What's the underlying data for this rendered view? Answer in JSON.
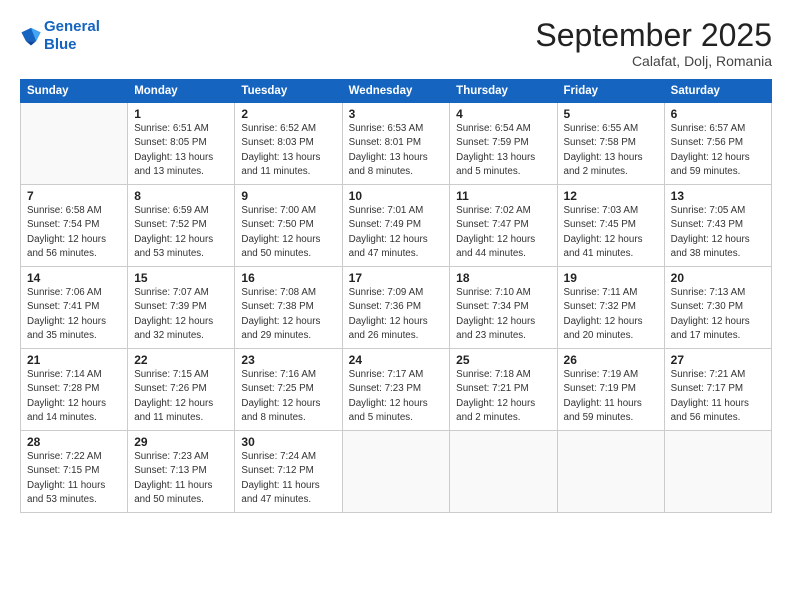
{
  "logo": {
    "line1": "General",
    "line2": "Blue"
  },
  "title": "September 2025",
  "location": "Calafat, Dolj, Romania",
  "days_header": [
    "Sunday",
    "Monday",
    "Tuesday",
    "Wednesday",
    "Thursday",
    "Friday",
    "Saturday"
  ],
  "weeks": [
    [
      {
        "day": "",
        "info": ""
      },
      {
        "day": "1",
        "info": "Sunrise: 6:51 AM\nSunset: 8:05 PM\nDaylight: 13 hours\nand 13 minutes."
      },
      {
        "day": "2",
        "info": "Sunrise: 6:52 AM\nSunset: 8:03 PM\nDaylight: 13 hours\nand 11 minutes."
      },
      {
        "day": "3",
        "info": "Sunrise: 6:53 AM\nSunset: 8:01 PM\nDaylight: 13 hours\nand 8 minutes."
      },
      {
        "day": "4",
        "info": "Sunrise: 6:54 AM\nSunset: 7:59 PM\nDaylight: 13 hours\nand 5 minutes."
      },
      {
        "day": "5",
        "info": "Sunrise: 6:55 AM\nSunset: 7:58 PM\nDaylight: 13 hours\nand 2 minutes."
      },
      {
        "day": "6",
        "info": "Sunrise: 6:57 AM\nSunset: 7:56 PM\nDaylight: 12 hours\nand 59 minutes."
      }
    ],
    [
      {
        "day": "7",
        "info": "Sunrise: 6:58 AM\nSunset: 7:54 PM\nDaylight: 12 hours\nand 56 minutes."
      },
      {
        "day": "8",
        "info": "Sunrise: 6:59 AM\nSunset: 7:52 PM\nDaylight: 12 hours\nand 53 minutes."
      },
      {
        "day": "9",
        "info": "Sunrise: 7:00 AM\nSunset: 7:50 PM\nDaylight: 12 hours\nand 50 minutes."
      },
      {
        "day": "10",
        "info": "Sunrise: 7:01 AM\nSunset: 7:49 PM\nDaylight: 12 hours\nand 47 minutes."
      },
      {
        "day": "11",
        "info": "Sunrise: 7:02 AM\nSunset: 7:47 PM\nDaylight: 12 hours\nand 44 minutes."
      },
      {
        "day": "12",
        "info": "Sunrise: 7:03 AM\nSunset: 7:45 PM\nDaylight: 12 hours\nand 41 minutes."
      },
      {
        "day": "13",
        "info": "Sunrise: 7:05 AM\nSunset: 7:43 PM\nDaylight: 12 hours\nand 38 minutes."
      }
    ],
    [
      {
        "day": "14",
        "info": "Sunrise: 7:06 AM\nSunset: 7:41 PM\nDaylight: 12 hours\nand 35 minutes."
      },
      {
        "day": "15",
        "info": "Sunrise: 7:07 AM\nSunset: 7:39 PM\nDaylight: 12 hours\nand 32 minutes."
      },
      {
        "day": "16",
        "info": "Sunrise: 7:08 AM\nSunset: 7:38 PM\nDaylight: 12 hours\nand 29 minutes."
      },
      {
        "day": "17",
        "info": "Sunrise: 7:09 AM\nSunset: 7:36 PM\nDaylight: 12 hours\nand 26 minutes."
      },
      {
        "day": "18",
        "info": "Sunrise: 7:10 AM\nSunset: 7:34 PM\nDaylight: 12 hours\nand 23 minutes."
      },
      {
        "day": "19",
        "info": "Sunrise: 7:11 AM\nSunset: 7:32 PM\nDaylight: 12 hours\nand 20 minutes."
      },
      {
        "day": "20",
        "info": "Sunrise: 7:13 AM\nSunset: 7:30 PM\nDaylight: 12 hours\nand 17 minutes."
      }
    ],
    [
      {
        "day": "21",
        "info": "Sunrise: 7:14 AM\nSunset: 7:28 PM\nDaylight: 12 hours\nand 14 minutes."
      },
      {
        "day": "22",
        "info": "Sunrise: 7:15 AM\nSunset: 7:26 PM\nDaylight: 12 hours\nand 11 minutes."
      },
      {
        "day": "23",
        "info": "Sunrise: 7:16 AM\nSunset: 7:25 PM\nDaylight: 12 hours\nand 8 minutes."
      },
      {
        "day": "24",
        "info": "Sunrise: 7:17 AM\nSunset: 7:23 PM\nDaylight: 12 hours\nand 5 minutes."
      },
      {
        "day": "25",
        "info": "Sunrise: 7:18 AM\nSunset: 7:21 PM\nDaylight: 12 hours\nand 2 minutes."
      },
      {
        "day": "26",
        "info": "Sunrise: 7:19 AM\nSunset: 7:19 PM\nDaylight: 11 hours\nand 59 minutes."
      },
      {
        "day": "27",
        "info": "Sunrise: 7:21 AM\nSunset: 7:17 PM\nDaylight: 11 hours\nand 56 minutes."
      }
    ],
    [
      {
        "day": "28",
        "info": "Sunrise: 7:22 AM\nSunset: 7:15 PM\nDaylight: 11 hours\nand 53 minutes."
      },
      {
        "day": "29",
        "info": "Sunrise: 7:23 AM\nSunset: 7:13 PM\nDaylight: 11 hours\nand 50 minutes."
      },
      {
        "day": "30",
        "info": "Sunrise: 7:24 AM\nSunset: 7:12 PM\nDaylight: 11 hours\nand 47 minutes."
      },
      {
        "day": "",
        "info": ""
      },
      {
        "day": "",
        "info": ""
      },
      {
        "day": "",
        "info": ""
      },
      {
        "day": "",
        "info": ""
      }
    ]
  ]
}
